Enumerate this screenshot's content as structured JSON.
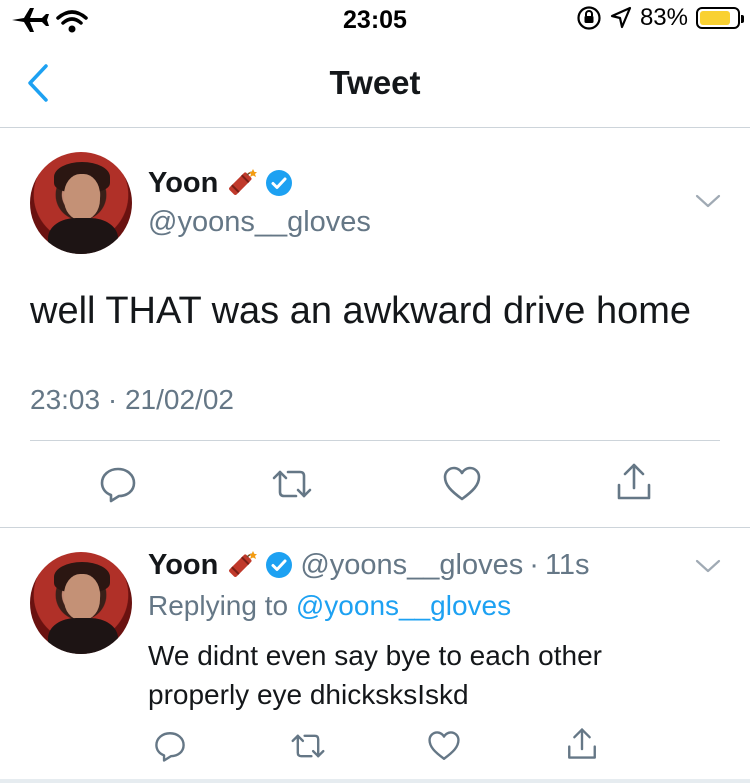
{
  "status_bar": {
    "time": "23:05",
    "battery_percent": "83%",
    "battery_level": 0.83,
    "battery_color": "#f9d132",
    "icons": [
      "airplane-icon",
      "wifi-icon",
      "orientation-lock-icon",
      "location-icon",
      "battery-icon"
    ]
  },
  "nav": {
    "title": "Tweet",
    "back_icon": "chevron-left-icon",
    "accent_color": "#1da1f2"
  },
  "main_tweet": {
    "author_name": "Yoon",
    "name_emoji": "dynamite-icon",
    "verified": true,
    "handle": "@yoons__gloves",
    "text": "well THAT was an awkward drive home",
    "time": "23:03",
    "separator": "·",
    "date": "21/02/02",
    "actions": [
      "reply-icon",
      "retweet-icon",
      "like-icon",
      "share-icon"
    ]
  },
  "reply_tweet": {
    "author_name": "Yoon",
    "name_emoji": "dynamite-icon",
    "verified": true,
    "handle": "@yoons__gloves",
    "separator": "·",
    "age": "11s",
    "replying_to_label": "Replying to",
    "replying_to_handle": "@yoons__gloves",
    "text_line1": "We didnt even say bye to each other",
    "text_line2": "properly eye dhicksksIskd",
    "actions": [
      "reply-icon",
      "retweet-icon",
      "like-icon",
      "share-icon"
    ]
  }
}
